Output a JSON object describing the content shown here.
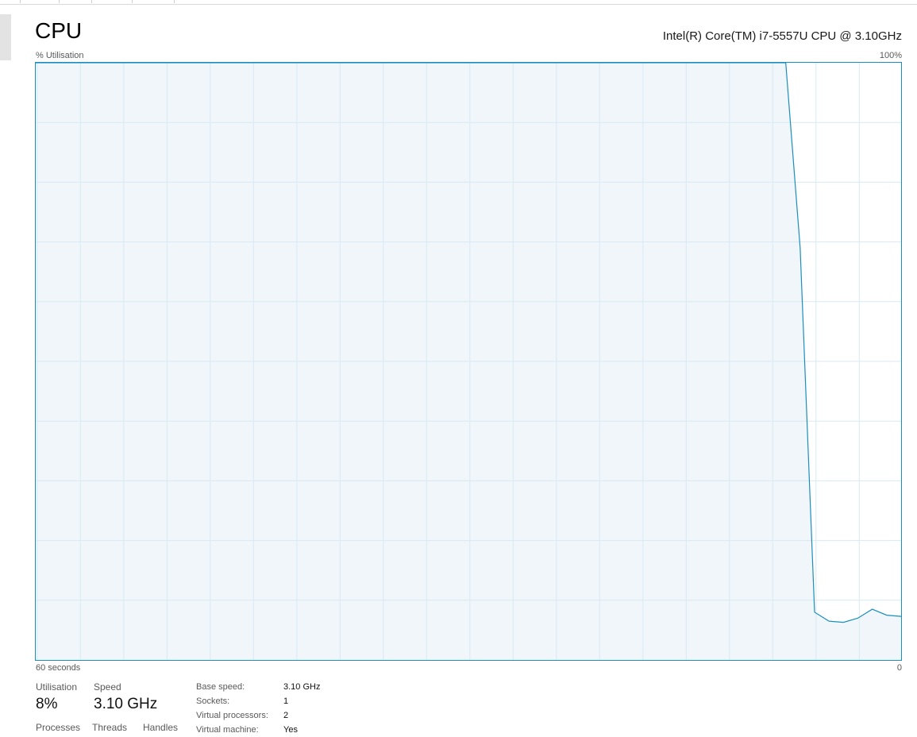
{
  "header": {
    "title": "CPU",
    "model": "Intel(R) Core(TM) i7-5557U CPU @ 3.10GHz"
  },
  "graph": {
    "y_label": "% Utilisation",
    "y_max_label": "100%",
    "x_label": "60 seconds",
    "x_min_label": "0"
  },
  "stats": {
    "utilisation_label": "Utilisation",
    "utilisation_value": "8%",
    "speed_label": "Speed",
    "speed_value": "3.10 GHz",
    "processes_label": "Processes",
    "threads_label": "Threads",
    "handles_label": "Handles"
  },
  "details": [
    {
      "key": "Base speed:",
      "value": "3.10 GHz"
    },
    {
      "key": "Sockets:",
      "value": "1"
    },
    {
      "key": "Virtual processors:",
      "value": "2"
    },
    {
      "key": "Virtual machine:",
      "value": "Yes"
    }
  ],
  "colors": {
    "line": "#1b8ebd",
    "fill": "#f1f6fa",
    "grid": "#d8e9f3",
    "border": "#1b8ebd"
  },
  "chart_data": {
    "type": "area",
    "x_range": [
      60,
      0
    ],
    "y_range": [
      0,
      100
    ],
    "x": [
      60,
      58,
      56,
      54,
      52,
      50,
      48,
      46,
      44,
      42,
      40,
      38,
      36,
      34,
      32,
      30,
      28,
      26,
      24,
      22,
      20,
      18,
      16,
      14,
      12,
      10,
      8,
      7,
      6,
      5,
      4,
      3,
      2,
      1,
      0
    ],
    "values": [
      100,
      100,
      100,
      100,
      100,
      100,
      100,
      100,
      100,
      100,
      100,
      100,
      100,
      100,
      100,
      100,
      100,
      100,
      100,
      100,
      100,
      100,
      100,
      100,
      100,
      100,
      100,
      69,
      8,
      6.5,
      6.3,
      7,
      8.5,
      7.5,
      7.3
    ],
    "grid": true
  }
}
